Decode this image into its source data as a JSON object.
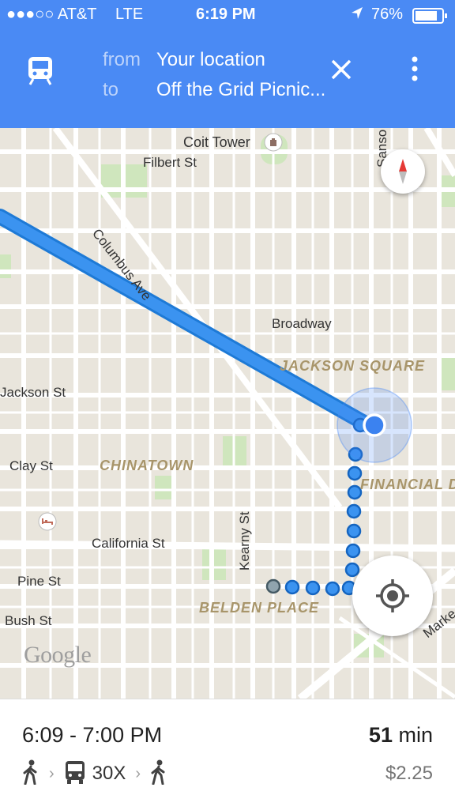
{
  "status_bar": {
    "carrier": "●●●○○ AT&T",
    "network": "LTE",
    "time": "6:19 PM",
    "battery": "76%"
  },
  "header": {
    "mode_icon": "transit-icon",
    "from_label": "from",
    "from_value": "Your location",
    "to_label": "to",
    "to_value": "Off the Grid Picnic..."
  },
  "map": {
    "landmark": "Coit Tower",
    "streets": [
      "Filbert St",
      "Columbus Ave",
      "Sanso",
      "Broadway",
      "Jackson St",
      "Clay St",
      "California St",
      "Kearny St",
      "Pine St",
      "Bush St",
      "Marke"
    ],
    "districts": [
      "JACKSON SQUARE",
      "CHINATOWN",
      "FINANCIAL DISTRICT",
      "BELDEN PLACE"
    ],
    "provider": "Google"
  },
  "route": {
    "time_range": "6:09 - 7:00 PM",
    "duration_value": "51",
    "duration_unit": "min",
    "fare": "$2.25",
    "bus_line": "30X",
    "steps": [
      "walk-icon",
      "bus-icon",
      "walk-icon"
    ]
  },
  "colors": {
    "header_blue": "#4a8af4",
    "route_blue": "#3b93f0",
    "map_bg": "#e9e5dc",
    "district_text": "#a8956a"
  }
}
